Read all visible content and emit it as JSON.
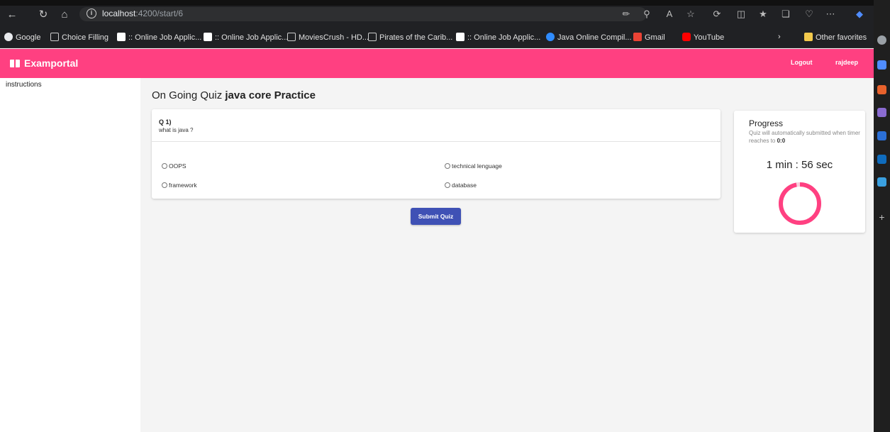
{
  "browser": {
    "url_host": "localhost",
    "url_path": ":4200/start/6",
    "bookmarks": [
      "Google",
      "Choice Filling",
      ":: Online Job Applic...",
      ":: Online Job Applic...",
      "MoviesCrush - HD...",
      "Pirates of the Carib...",
      ":: Online Job Applic...",
      "Java Online Compil...",
      "Gmail",
      "YouTube"
    ],
    "other_favorites": "Other favorites"
  },
  "navbar": {
    "brand": "Examportal",
    "logout": "Logout",
    "username": "rajdeep",
    "color": "#ff4081"
  },
  "sidebar": {
    "instructions": "instructions"
  },
  "quiz": {
    "title_prefix": "On Going Quiz",
    "title_name": "java core Practice",
    "question_number": "Q 1)",
    "question_text": "what is java ?",
    "options": [
      "OOPS",
      "technical lenguage",
      "framework",
      "database"
    ],
    "submit_label": "Submit Quiz",
    "submit_color": "#3f51b5"
  },
  "progress": {
    "title": "Progress",
    "subtitle": "Quiz will automatically submitted when timer reaches to",
    "subtitle_value": "0:0",
    "timer": "1 min : 56 sec",
    "fraction_remaining": 0.97,
    "ring_color": "#ff4081"
  }
}
